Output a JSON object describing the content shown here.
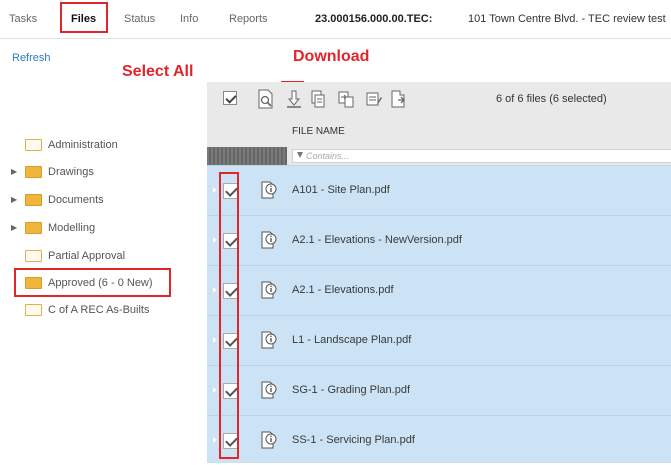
{
  "tabs": [
    {
      "label": "Tasks"
    },
    {
      "label": "Files"
    },
    {
      "label": "Status"
    },
    {
      "label": "Info"
    },
    {
      "label": "Reports"
    }
  ],
  "project": {
    "code": "23.000156.000.00.TEC:",
    "name": "101 Town Centre Blvd. - TEC review test"
  },
  "refresh_label": "Refresh",
  "annotations": {
    "select_all": "Select All",
    "download": "Download"
  },
  "toolbar": {
    "selection_count": "6 of 6 files (6 selected)",
    "icons": [
      "select-all-checkbox",
      "preview-icon",
      "download-icon",
      "copy-icon",
      "move-icon",
      "edit-icon",
      "export-icon"
    ]
  },
  "tree": [
    {
      "label": "Administration",
      "expandable": false
    },
    {
      "label": "Drawings",
      "expandable": true
    },
    {
      "label": "Documents",
      "expandable": true
    },
    {
      "label": "Modelling",
      "expandable": true
    },
    {
      "label": "Partial Approval",
      "expandable": false
    },
    {
      "label": "Approved (6 - 0 New)",
      "expandable": false,
      "selected": true
    },
    {
      "label": "C of A REC As-Builts",
      "expandable": false
    }
  ],
  "grid": {
    "column_header": "FILE NAME",
    "filter_placeholder": "Contains...",
    "files": [
      {
        "name": "A101 - Site Plan.pdf",
        "checked": true
      },
      {
        "name": "A2.1 - Elevations - NewVersion.pdf",
        "checked": true
      },
      {
        "name": "A2.1 - Elevations.pdf",
        "checked": true
      },
      {
        "name": "L1 - Landscape Plan.pdf",
        "checked": true
      },
      {
        "name": "SG-1 - Grading Plan.pdf",
        "checked": true
      },
      {
        "name": "SS-1 - Servicing Plan.pdf",
        "checked": true
      }
    ]
  },
  "colors": {
    "annotation": "#e0262b",
    "row_selected": "#cbe3f5",
    "link": "#2b7bc4",
    "folder": "#f2b53b"
  }
}
